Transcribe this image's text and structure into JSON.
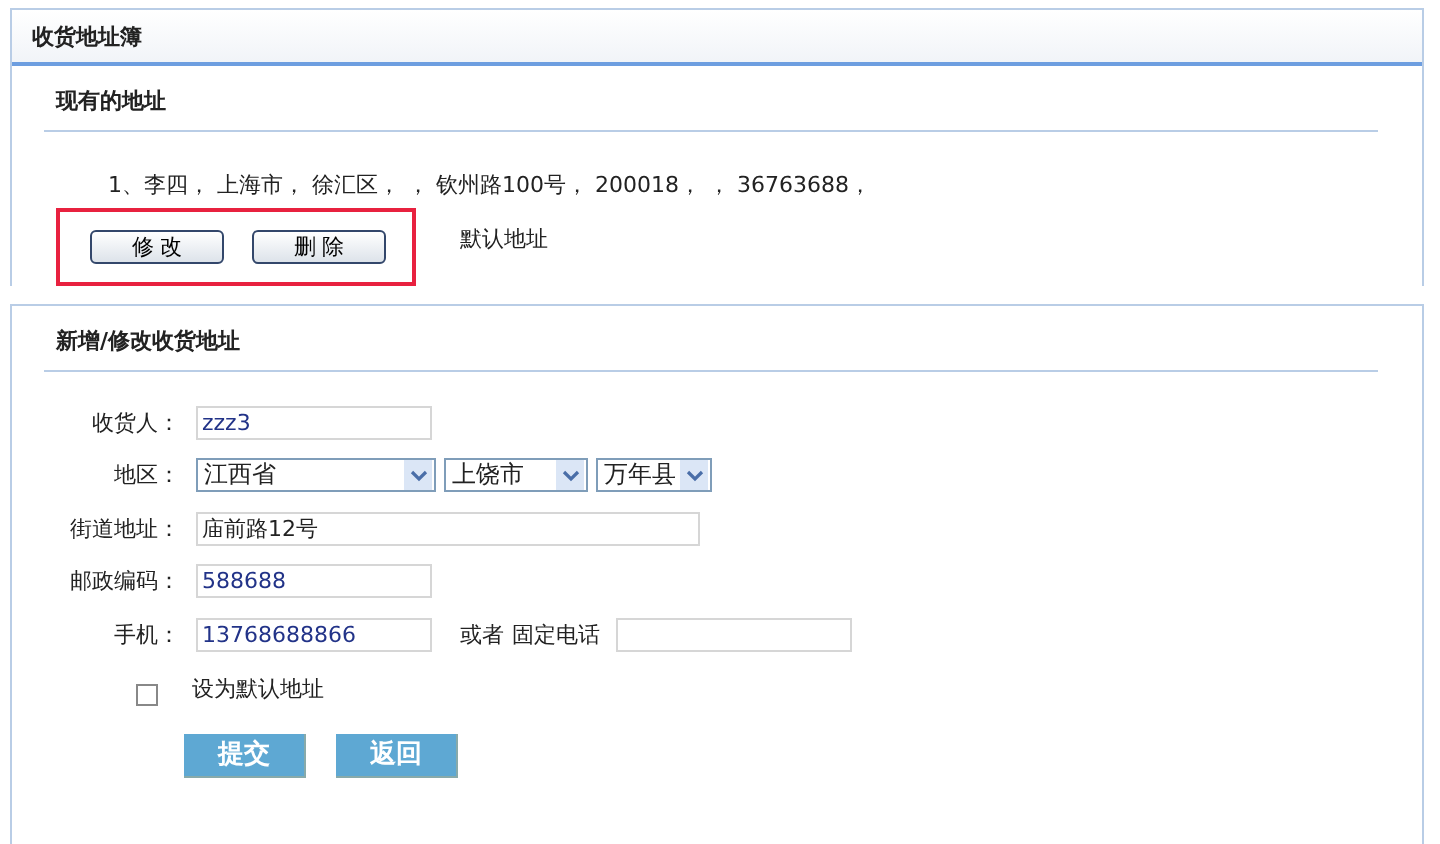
{
  "panel": {
    "title": "收货地址簿"
  },
  "existing": {
    "title": "现有的地址",
    "addresses": [
      {
        "text": "1、李四， 上海市， 徐汇区，  ，  钦州路100号， 200018，  ，  36763688，",
        "highlighted": true,
        "buttons": [
          "修 改",
          "删 除"
        ],
        "default_label": "默认地址"
      }
    ]
  },
  "form": {
    "title": "新增/修改收货地址",
    "fields": [
      {
        "kind": "text",
        "label": "收货人：",
        "value": "zzz3"
      },
      {
        "kind": "region",
        "label": "地区：",
        "selects": [
          "江西省",
          "上饶市",
          "万年县"
        ]
      },
      {
        "kind": "long_text",
        "label": "街道地址：",
        "value": "庙前路12号"
      },
      {
        "kind": "text",
        "label": "邮政编码：",
        "value": "588688"
      },
      {
        "kind": "phone",
        "label": "手机：",
        "value": "13768688866",
        "or_label": "或者",
        "extra_label": "固定电话"
      }
    ],
    "default_checkbox": {
      "label": "设为默认地址",
      "checked": false
    },
    "buttons": [
      "提交",
      "返回"
    ]
  }
}
